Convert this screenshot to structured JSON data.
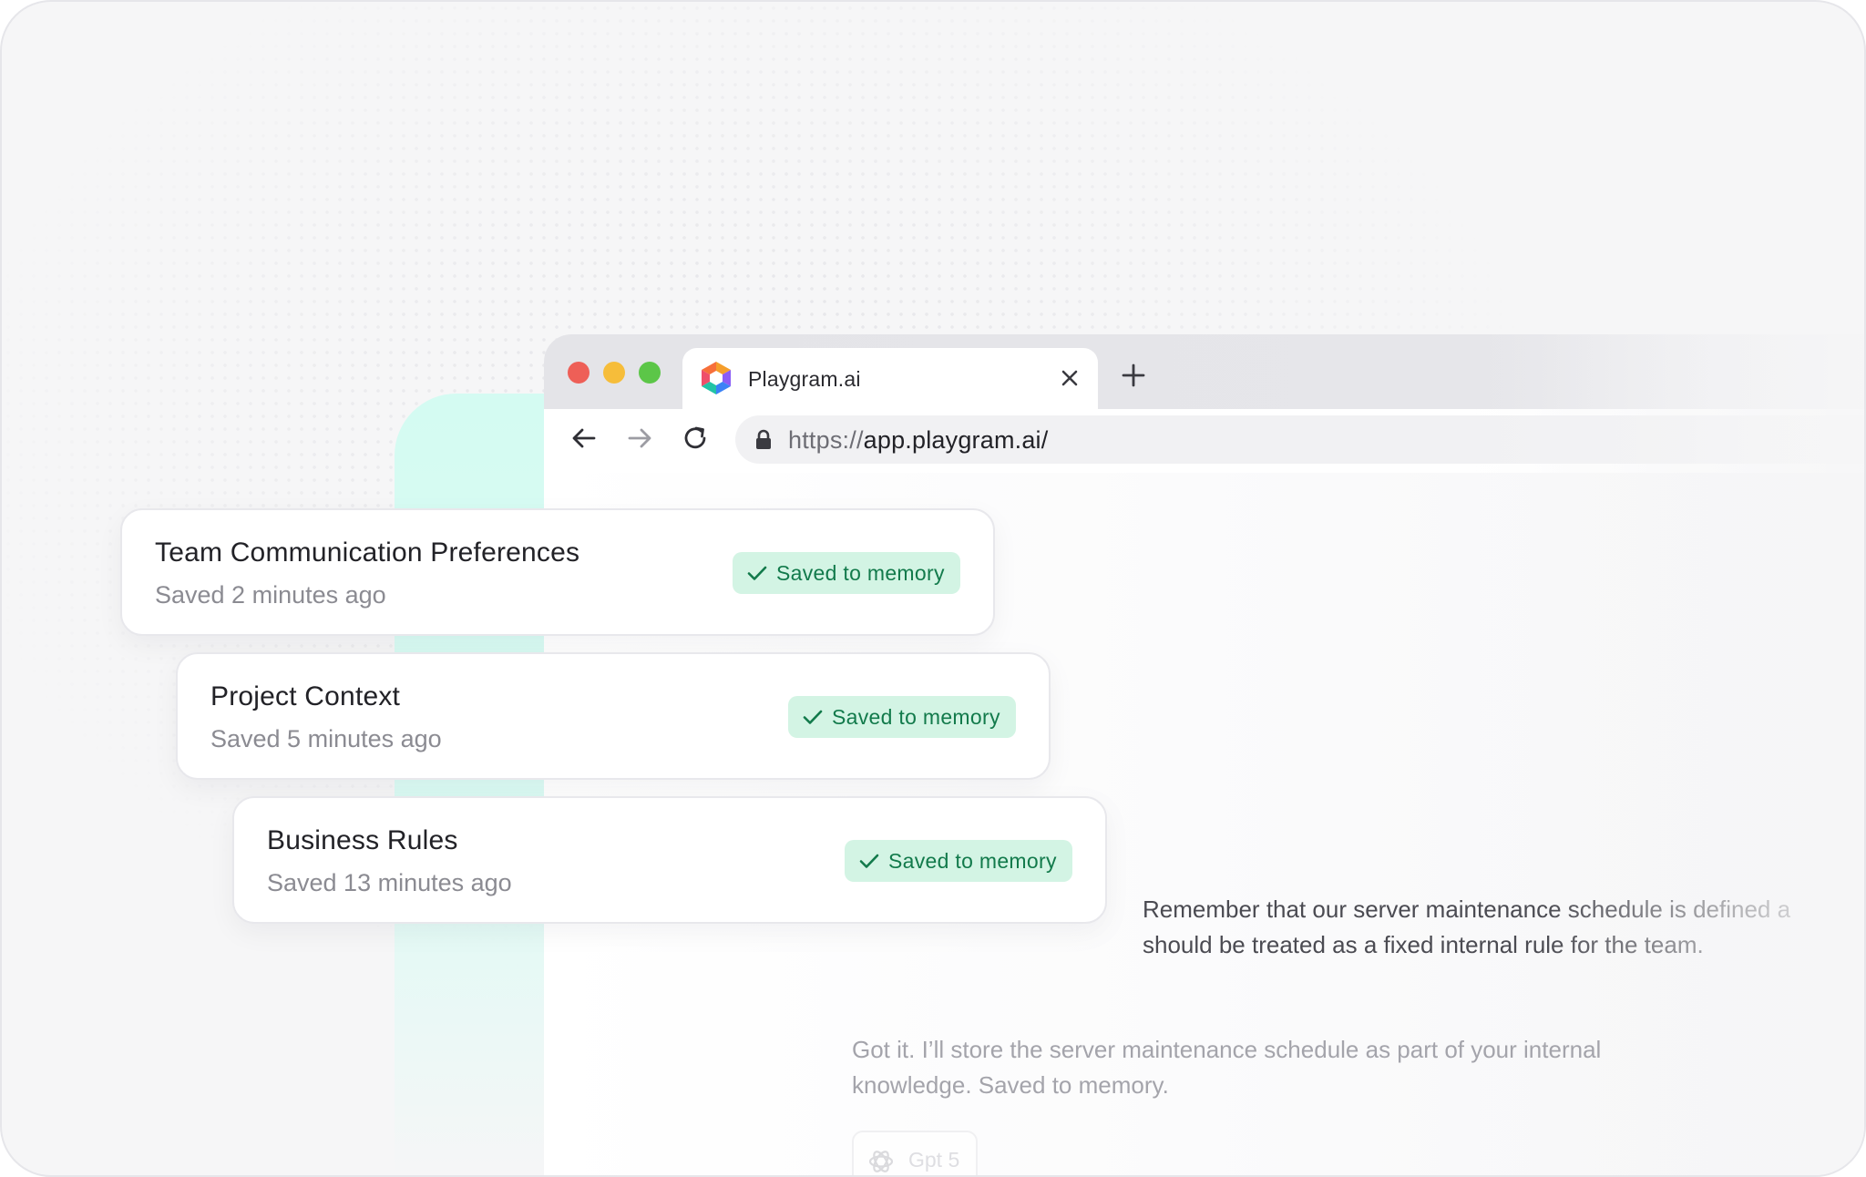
{
  "browser": {
    "tab_title": "Playgram.ai",
    "url_scheme": "https://",
    "url_host": "app.playgram.ai/"
  },
  "memory_cards": [
    {
      "title": "Team Communication Preferences",
      "subtitle": "Saved 2 minutes ago",
      "badge": "Saved to memory"
    },
    {
      "title": "Project Context",
      "subtitle": "Saved 5 minutes ago",
      "badge": "Saved to memory"
    },
    {
      "title": "Business Rules",
      "subtitle": "Saved 13 minutes ago",
      "badge": "Saved to memory"
    }
  ],
  "chat": {
    "user_message_line1": "Remember that our server maintenance schedule is defined a",
    "user_message_line2": "should be treated as a fixed internal rule for the team.",
    "assistant_message": "Got it. I’ll store the server maintenance schedule as part of your internal knowledge. Saved to memory.",
    "model_label": "Gpt 5"
  },
  "icons": {
    "tab_logo": "playgram-logo-icon",
    "close": "close-icon",
    "new_tab": "plus-icon",
    "back": "arrow-left-icon",
    "forward": "arrow-right-icon",
    "reload": "reload-icon",
    "lock": "lock-icon",
    "check": "check-icon",
    "model": "openai-icon"
  },
  "colors": {
    "badge_bg": "#d3f4e4",
    "badge_text": "#127a4b",
    "accent_mint": "#d4fbf2",
    "traffic_red": "#ee5f57",
    "traffic_yellow": "#f6bd3a",
    "traffic_green": "#5cc648"
  }
}
